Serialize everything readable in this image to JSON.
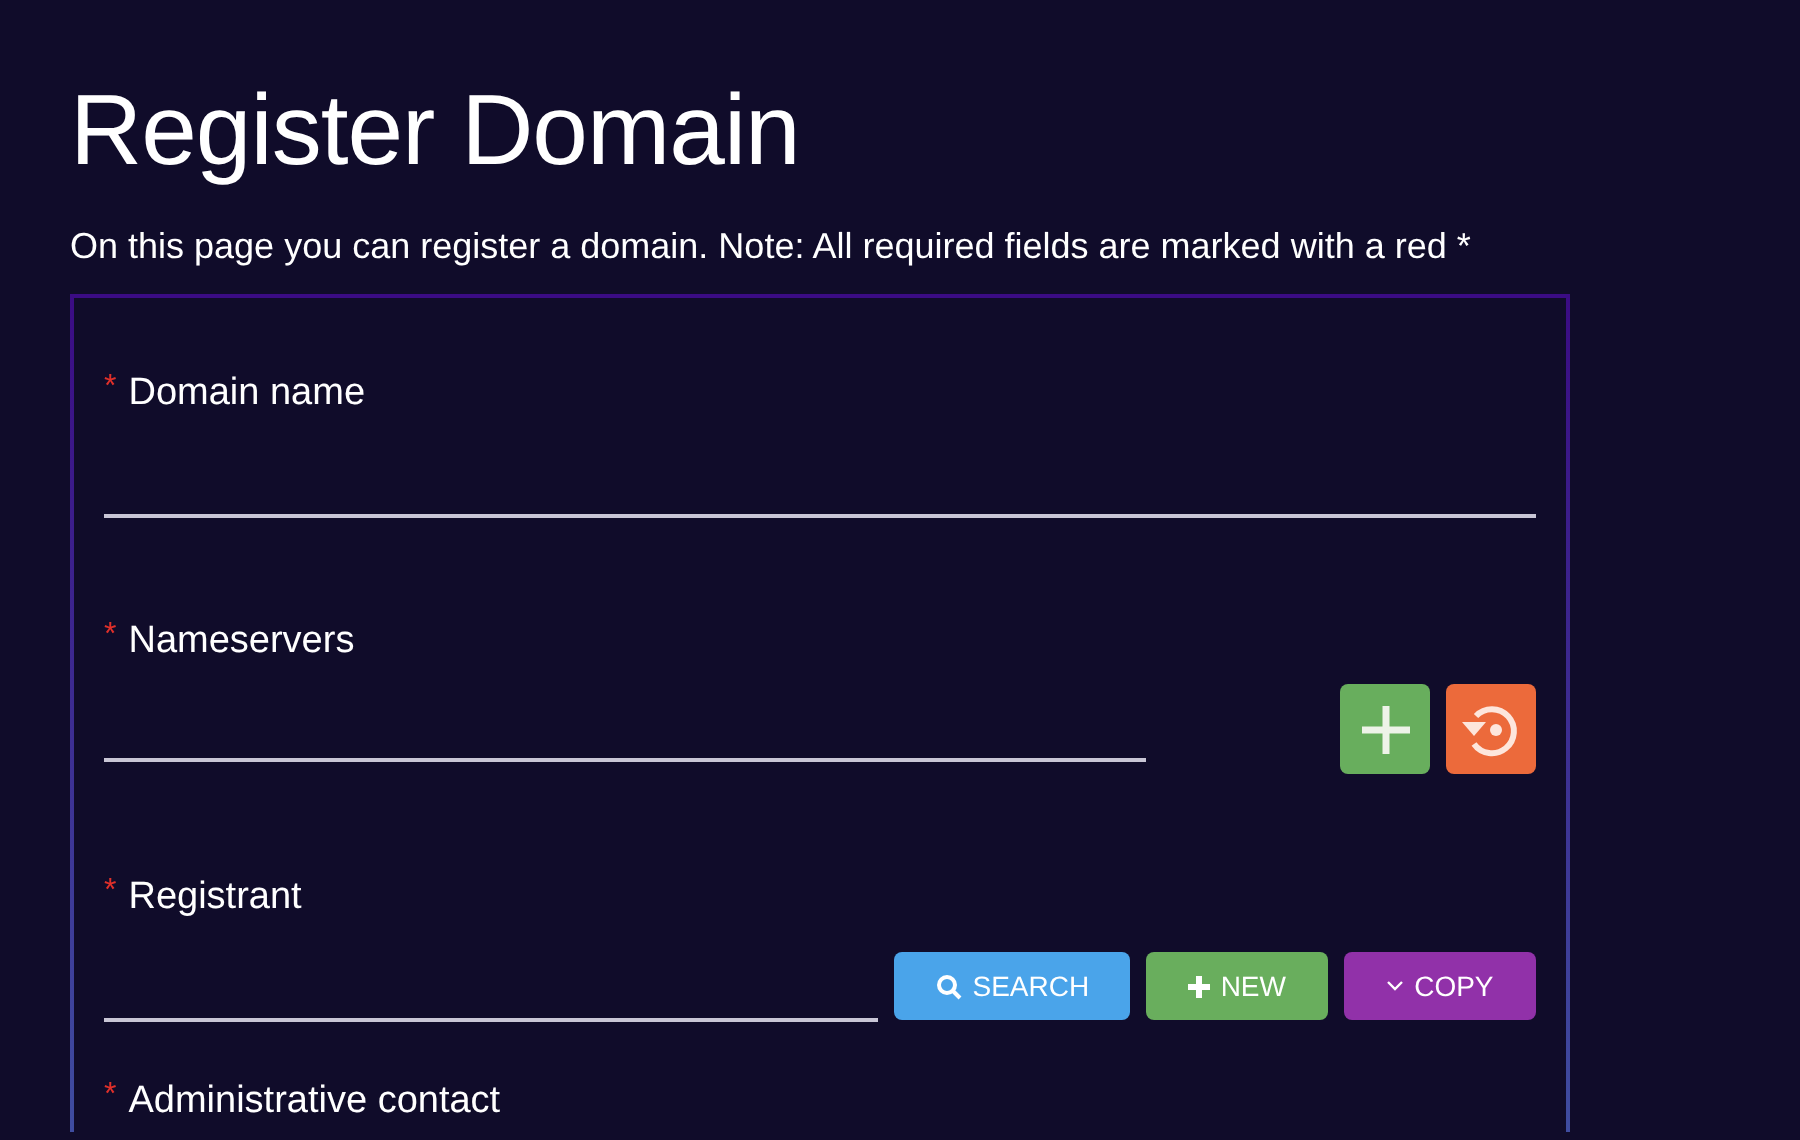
{
  "title": "Register Domain",
  "intro": "On this page you can register a domain. Note: All required fields are marked with a red *",
  "fields": [
    {
      "kind": "text",
      "label": "Domain name",
      "required_mark": "*"
    },
    {
      "kind": "list",
      "label": "Nameservers",
      "required_mark": "*",
      "buttons": [
        {
          "kind": "add"
        },
        {
          "kind": "reset"
        }
      ]
    },
    {
      "kind": "contact",
      "label": "Registrant",
      "required_mark": "*",
      "buttons": [
        {
          "kind": "search",
          "label": "SEARCH"
        },
        {
          "kind": "new",
          "label": "NEW"
        },
        {
          "kind": "copy",
          "label": "COPY"
        }
      ]
    },
    {
      "kind": "contact",
      "label": "Administrative contact",
      "required_mark": "*"
    }
  ]
}
